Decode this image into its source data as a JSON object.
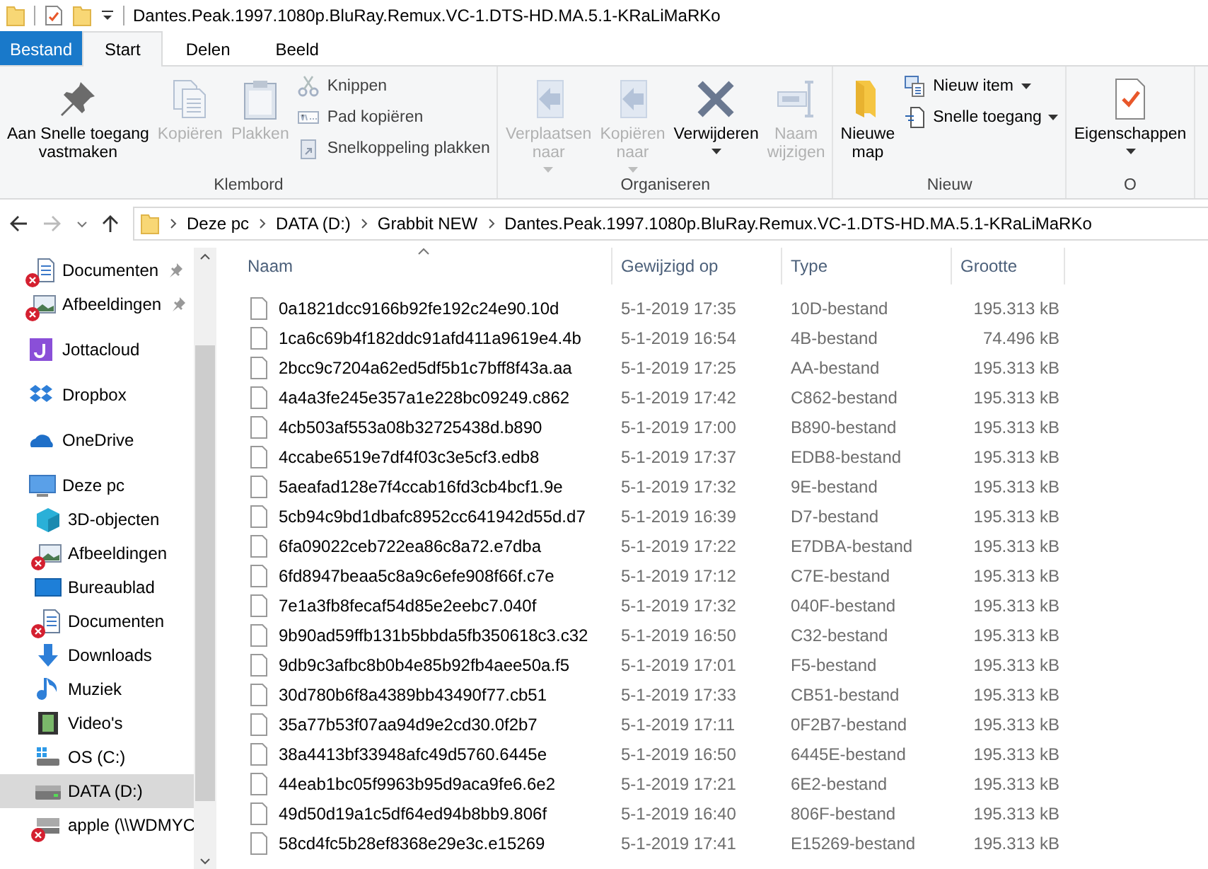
{
  "window": {
    "title": "Dantes.Peak.1997.1080p.BluRay.Remux.VC-1.DTS-HD.MA.5.1-KRaLiMaRKo"
  },
  "tabs": [
    {
      "label": "Bestand",
      "kind": "file_menu",
      "selected": false
    },
    {
      "label": "Start",
      "kind": "tab",
      "selected": true
    },
    {
      "label": "Delen",
      "kind": "tab",
      "selected": false
    },
    {
      "label": "Beeld",
      "kind": "tab",
      "selected": false
    }
  ],
  "ribbon": {
    "groups": [
      {
        "label": "Klembord",
        "buttons": [
          {
            "label": "Aan Snelle toegang\nvastmaken",
            "disabled": false,
            "dropdown": false
          },
          {
            "label": "Kopiëren",
            "disabled": true,
            "dropdown": false
          },
          {
            "label": "Plakken",
            "disabled": true,
            "dropdown": false
          }
        ],
        "small": [
          {
            "label": "Knippen",
            "disabled": true,
            "dropdown": false
          },
          {
            "label": "Pad kopiëren",
            "disabled": true,
            "dropdown": false
          },
          {
            "label": "Snelkoppeling plakken",
            "disabled": true,
            "dropdown": false
          }
        ]
      },
      {
        "label": "Organiseren",
        "buttons": [
          {
            "label": "Verplaatsen\nnaar",
            "disabled": true,
            "dropdown": true
          },
          {
            "label": "Kopiëren\nnaar",
            "disabled": true,
            "dropdown": true
          },
          {
            "label": "Verwijderen",
            "disabled": false,
            "dropdown": true
          },
          {
            "label": "Naam\nwijzigen",
            "disabled": true,
            "dropdown": false
          }
        ]
      },
      {
        "label": "Nieuw",
        "buttons": [
          {
            "label": "Nieuwe\nmap",
            "disabled": false,
            "dropdown": false
          }
        ],
        "small": [
          {
            "label": "Nieuw item",
            "disabled": false,
            "dropdown": true
          },
          {
            "label": "Snelle toegang",
            "disabled": false,
            "dropdown": true
          }
        ]
      },
      {
        "label": "O",
        "buttons": [
          {
            "label": "Eigenschappen",
            "disabled": false,
            "dropdown": true
          }
        ]
      }
    ]
  },
  "address": {
    "segments": [
      "Deze pc",
      "DATA (D:)",
      "Grabbit NEW",
      "Dantes.Peak.1997.1080p.BluRay.Remux.VC-1.DTS-HD.MA.5.1-KRaLiMaRKo"
    ]
  },
  "sidebar": {
    "items": [
      {
        "label": "Documenten",
        "pinned": true,
        "error": true,
        "selected": false
      },
      {
        "label": "Afbeeldingen",
        "pinned": true,
        "error": true,
        "selected": false
      },
      {
        "label": "Jottacloud",
        "pinned": false,
        "error": false,
        "selected": false
      },
      {
        "label": "Dropbox",
        "pinned": false,
        "error": false,
        "selected": false
      },
      {
        "label": "OneDrive",
        "pinned": false,
        "error": false,
        "selected": false
      },
      {
        "label": "Deze pc",
        "pinned": false,
        "error": false,
        "selected": false,
        "children": [
          {
            "label": "3D-objecten",
            "pinned": false,
            "error": false,
            "selected": false
          },
          {
            "label": "Afbeeldingen",
            "pinned": false,
            "error": true,
            "selected": false
          },
          {
            "label": "Bureaublad",
            "pinned": false,
            "error": false,
            "selected": false
          },
          {
            "label": "Documenten",
            "pinned": false,
            "error": true,
            "selected": false
          },
          {
            "label": "Downloads",
            "pinned": false,
            "error": false,
            "selected": false
          },
          {
            "label": "Muziek",
            "pinned": false,
            "error": false,
            "selected": false
          },
          {
            "label": "Video's",
            "pinned": false,
            "error": false,
            "selected": false
          },
          {
            "label": "OS (C:)",
            "pinned": false,
            "error": false,
            "selected": false
          },
          {
            "label": "DATA (D:)",
            "pinned": false,
            "error": false,
            "selected": true
          },
          {
            "label": "apple (\\\\WDMYC",
            "pinned": false,
            "error": true,
            "selected": false
          }
        ]
      }
    ]
  },
  "table": {
    "columns": [
      {
        "label": "Naam",
        "sorted": true
      },
      {
        "label": "Gewijzigd op",
        "sorted": false
      },
      {
        "label": "Type",
        "sorted": false
      },
      {
        "label": "Grootte",
        "sorted": false
      }
    ],
    "rows": [
      [
        "0a1821dcc9166b92fe192c24e90.10d",
        "5-1-2019 17:35",
        "10D-bestand",
        "195.313 kB"
      ],
      [
        "1ca6c69b4f182ddc91afd411a9619e4.4b",
        "5-1-2019 16:54",
        "4B-bestand",
        "74.496 kB"
      ],
      [
        "2bcc9c7204a62ed5df5b1c7bff8f43a.aa",
        "5-1-2019 17:25",
        "AA-bestand",
        "195.313 kB"
      ],
      [
        "4a4a3fe245e357a1e228bc09249.c862",
        "5-1-2019 17:42",
        "C862-bestand",
        "195.313 kB"
      ],
      [
        "4cb503af553a08b32725438d.b890",
        "5-1-2019 17:00",
        "B890-bestand",
        "195.313 kB"
      ],
      [
        "4ccabe6519e7df4f03c3e5cf3.edb8",
        "5-1-2019 17:37",
        "EDB8-bestand",
        "195.313 kB"
      ],
      [
        "5aeafad128e7f4ccab16fd3cb4bcf1.9e",
        "5-1-2019 17:32",
        "9E-bestand",
        "195.313 kB"
      ],
      [
        "5cb94c9bd1dbafc8952cc641942d55d.d7",
        "5-1-2019 16:39",
        "D7-bestand",
        "195.313 kB"
      ],
      [
        "6fa09022ceb722ea86c8a72.e7dba",
        "5-1-2019 17:22",
        "E7DBA-bestand",
        "195.313 kB"
      ],
      [
        "6fd8947beaa5c8a9c6efe908f66f.c7e",
        "5-1-2019 17:12",
        "C7E-bestand",
        "195.313 kB"
      ],
      [
        "7e1a3fb8fecaf54d85e2eebc7.040f",
        "5-1-2019 17:32",
        "040F-bestand",
        "195.313 kB"
      ],
      [
        "9b90ad59ffb131b5bbda5fb350618c3.c32",
        "5-1-2019 16:50",
        "C32-bestand",
        "195.313 kB"
      ],
      [
        "9db9c3afbc8b0b4e85b92fb4aee50a.f5",
        "5-1-2019 17:01",
        "F5-bestand",
        "195.313 kB"
      ],
      [
        "30d780b6f8a4389bb43490f77.cb51",
        "5-1-2019 17:33",
        "CB51-bestand",
        "195.313 kB"
      ],
      [
        "35a77b53f07aa94d9e2cd30.0f2b7",
        "5-1-2019 17:11",
        "0F2B7-bestand",
        "195.313 kB"
      ],
      [
        "38a4413bf33948afc49d5760.6445e",
        "5-1-2019 16:50",
        "6445E-bestand",
        "195.313 kB"
      ],
      [
        "44eab1bc05f9963b95d9aca9fe6.6e2",
        "5-1-2019 17:21",
        "6E2-bestand",
        "195.313 kB"
      ],
      [
        "49d50d19a1c5df64ed94b8bb9.806f",
        "5-1-2019 16:40",
        "806F-bestand",
        "195.313 kB"
      ],
      [
        "58cd4fc5b28ef8368e29e3c.e15269",
        "5-1-2019 17:41",
        "E15269-bestand",
        "195.313 kB"
      ]
    ]
  }
}
